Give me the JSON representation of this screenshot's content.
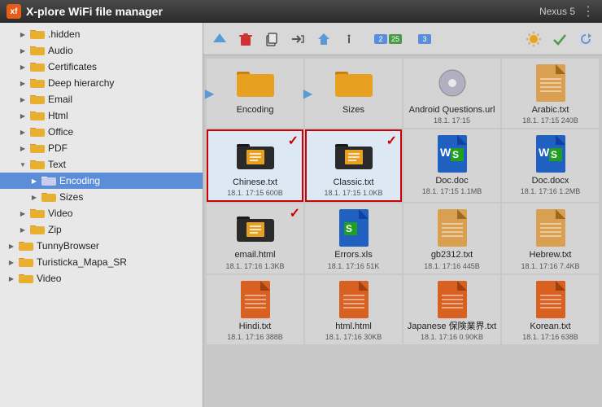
{
  "titleBar": {
    "appIcon": "xf",
    "title": "X-plore WiFi file manager",
    "deviceName": "Nexus 5"
  },
  "toolbar": {
    "buttons": [
      {
        "name": "up-icon",
        "symbol": "↑"
      },
      {
        "name": "delete-icon",
        "symbol": "🗑"
      },
      {
        "name": "copy-icon",
        "symbol": "📋"
      },
      {
        "name": "move-icon",
        "symbol": "✂"
      },
      {
        "name": "home-icon",
        "symbol": "⬆"
      },
      {
        "name": "info-icon",
        "symbol": "ℹ"
      },
      {
        "name": "battery-icon",
        "symbol": "🔋"
      },
      {
        "name": "check-icon",
        "symbol": "✓"
      },
      {
        "name": "refresh-icon",
        "symbol": "↻"
      }
    ],
    "badge1": "2",
    "badge2": "3",
    "badge3": "25"
  },
  "sidebar": {
    "items": [
      {
        "label": ".hidden",
        "indent": 1,
        "expanded": false,
        "selected": false
      },
      {
        "label": "Audio",
        "indent": 1,
        "expanded": false,
        "selected": false
      },
      {
        "label": "Certificates",
        "indent": 1,
        "expanded": false,
        "selected": false
      },
      {
        "label": "Deep hierarchy",
        "indent": 1,
        "expanded": false,
        "selected": false
      },
      {
        "label": "Email",
        "indent": 1,
        "expanded": false,
        "selected": false
      },
      {
        "label": "Html",
        "indent": 1,
        "expanded": false,
        "selected": false
      },
      {
        "label": "Office",
        "indent": 1,
        "expanded": false,
        "selected": false
      },
      {
        "label": "PDF",
        "indent": 1,
        "expanded": false,
        "selected": false
      },
      {
        "label": "Text",
        "indent": 1,
        "expanded": true,
        "selected": false
      },
      {
        "label": "Encoding",
        "indent": 2,
        "expanded": false,
        "selected": true
      },
      {
        "label": "Sizes",
        "indent": 2,
        "expanded": false,
        "selected": false
      },
      {
        "label": "Video",
        "indent": 1,
        "expanded": false,
        "selected": false
      },
      {
        "label": "Zip",
        "indent": 1,
        "expanded": false,
        "selected": false
      },
      {
        "label": "TunnyBrowser",
        "indent": 0,
        "expanded": false,
        "selected": false
      },
      {
        "label": "Turisticka_Mapa_SR",
        "indent": 0,
        "expanded": false,
        "selected": false
      },
      {
        "label": "Video",
        "indent": 0,
        "expanded": false,
        "selected": false
      }
    ]
  },
  "files": [
    {
      "name": "Encoding",
      "type": "folder",
      "color": "orange",
      "meta": "",
      "selected": false,
      "hasArrow": true
    },
    {
      "name": "Sizes",
      "type": "folder",
      "color": "orange",
      "meta": "",
      "selected": false,
      "hasArrow": true
    },
    {
      "name": "Android Questions.url",
      "type": "disc",
      "meta": "18.1. 17:15",
      "selected": false
    },
    {
      "name": "Arabic.txt",
      "type": "doc-plain",
      "meta": "18.1. 17:15  240B",
      "selected": false
    },
    {
      "name": "Chinese.txt",
      "type": "folder-dark",
      "meta": "18.1. 17:15  600B",
      "selected": true,
      "checked": true
    },
    {
      "name": "Classic.txt",
      "type": "folder-dark",
      "meta": "18.1. 17:15  1.0KB",
      "selected": true,
      "checked": true
    },
    {
      "name": "Doc.doc",
      "type": "doc-word",
      "meta": "18.1. 17:15  1.1MB",
      "selected": false
    },
    {
      "name": "Doc.docx",
      "type": "doc-word2",
      "meta": "18.1. 17:16  1.2MB",
      "selected": false
    },
    {
      "name": "email.html",
      "type": "folder-dark",
      "meta": "18.1. 17:16  1.3KB",
      "selected": false,
      "checked": true
    },
    {
      "name": "Errors.xls",
      "type": "doc-excel",
      "meta": "18.1. 17:16  51K",
      "selected": false
    },
    {
      "name": "gb2312.txt",
      "type": "doc-plain",
      "meta": "18.1. 17:16  445B",
      "selected": false
    },
    {
      "name": "Hebrew.txt",
      "type": "doc-plain",
      "meta": "18.1. 17:16  7.4KB",
      "selected": false
    },
    {
      "name": "Hindi.txt",
      "type": "doc-plain-orange",
      "meta": "18.1. 17:16  388B",
      "selected": false
    },
    {
      "name": "html.html",
      "type": "doc-plain-orange",
      "meta": "18.1. 17:16  30KB",
      "selected": false
    },
    {
      "name": "Japanese 保険業界.txt",
      "type": "doc-plain-orange",
      "meta": "18.1. 17:16  0.90KB",
      "selected": false
    },
    {
      "name": "Korean.txt",
      "type": "doc-plain-orange",
      "meta": "18.1. 17:16  638B",
      "selected": false
    }
  ]
}
